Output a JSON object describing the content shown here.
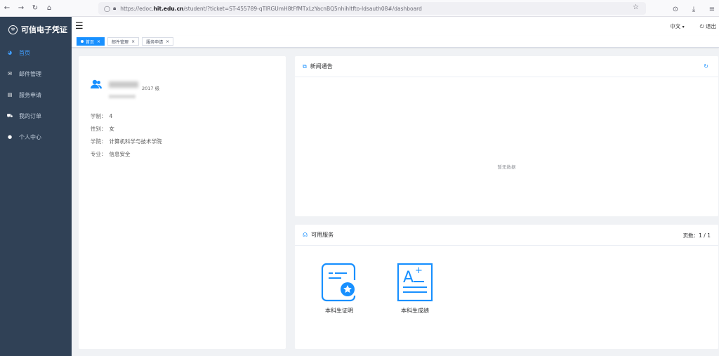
{
  "browser": {
    "url_prefix": "https://edoc.",
    "url_domain": "hit.edu.cn",
    "url_path": "/student/?ticket=ST-455789-qTlRGUmH8tFfMTxLzYacnBQ5nhihltfto-ldsauth08#/dashboard"
  },
  "sidebar": {
    "brand": "可信电子凭证",
    "items": [
      {
        "label": "首页",
        "icon": "dashboard-icon"
      },
      {
        "label": "邮件管理",
        "icon": "mail-icon"
      },
      {
        "label": "服务申请",
        "icon": "document-icon"
      },
      {
        "label": "我的订单",
        "icon": "cart-icon"
      },
      {
        "label": "个人中心",
        "icon": "user-icon"
      }
    ]
  },
  "navbar": {
    "language": "中文",
    "logout": "退出"
  },
  "tags": [
    {
      "label": "首页"
    },
    {
      "label": "邮件管理"
    },
    {
      "label": "服务申请"
    }
  ],
  "profile": {
    "grade": "2017 级",
    "fields": [
      {
        "label": "学制：",
        "value": "4"
      },
      {
        "label": "性别：",
        "value": "女"
      },
      {
        "label": "学院：",
        "value": "计算机科学与技术学院"
      },
      {
        "label": "专业：",
        "value": "信息安全"
      }
    ]
  },
  "news": {
    "title": "新闻通告",
    "empty_text": "暂无数据"
  },
  "services": {
    "title": "可用服务",
    "pages": "页数：1 / 1",
    "items": [
      {
        "label": "本科生证明",
        "icon": "certificate-icon"
      },
      {
        "label": "本科生成绩",
        "icon": "grade-report-icon"
      }
    ]
  },
  "colors": {
    "sidebar_bg": "#304156",
    "accent": "#1890ff"
  }
}
